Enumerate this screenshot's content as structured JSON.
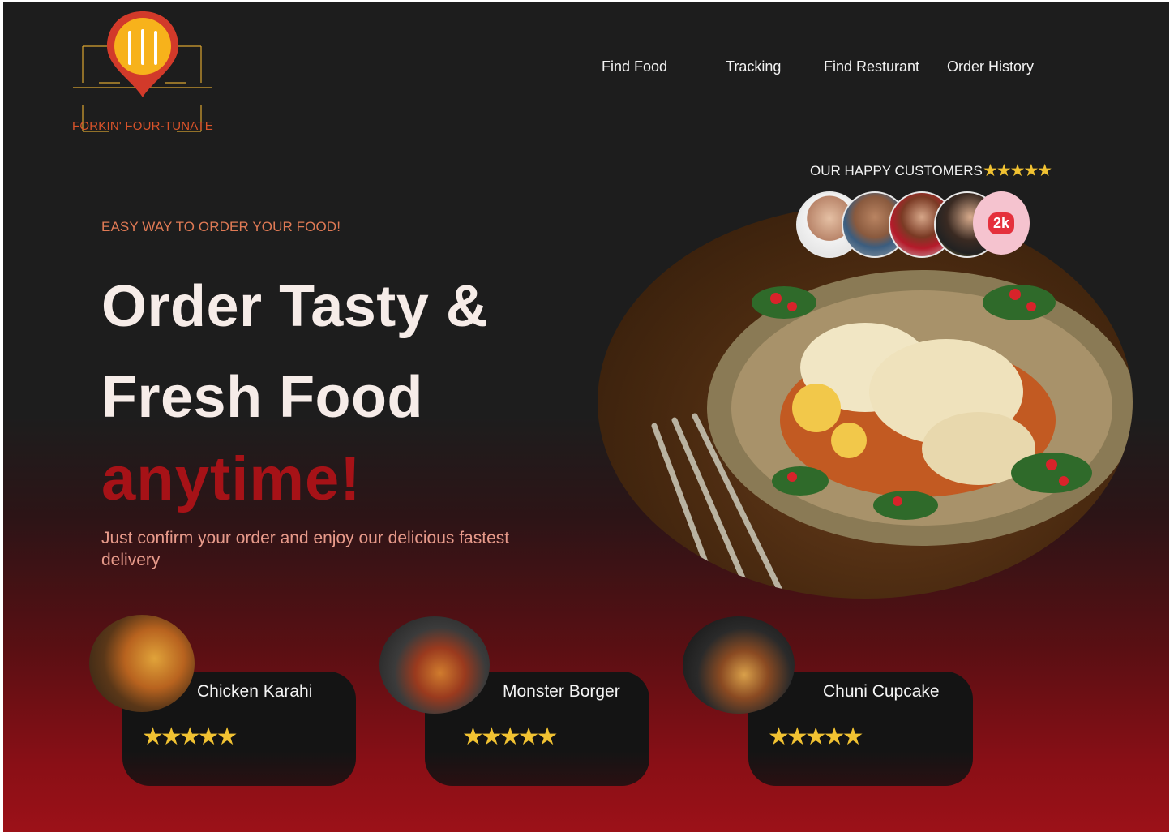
{
  "brand": {
    "name": "FORKIN' FOUR-TUNATE"
  },
  "nav": [
    "Find Food",
    "Tracking",
    "Find Resturant",
    "Order History"
  ],
  "hero": {
    "tagline": "EASY WAY TO ORDER YOUR FOOD!",
    "headline_line1": "Order Tasty &",
    "headline_line2": "Fresh Food",
    "headline_accent": "anytime!",
    "subtext": "Just confirm your order and enjoy our delicious fastest delivery"
  },
  "customers": {
    "label": "OUR HAPPY CUSTOMERS",
    "rating_stars": 5,
    "stars": "★★★★★",
    "badge": "2k"
  },
  "cards": [
    {
      "title": "Chicken Karahi",
      "stars": "★★★★★",
      "rating": 5
    },
    {
      "title": "Monster Borger",
      "stars": "★★★★★",
      "rating": 5
    },
    {
      "title": "Chuni Cupcake",
      "stars": "★★★★★",
      "rating": 5
    }
  ],
  "colors": {
    "accent": "#a61217",
    "tagline": "#e07a55",
    "star": "#f1c232"
  }
}
